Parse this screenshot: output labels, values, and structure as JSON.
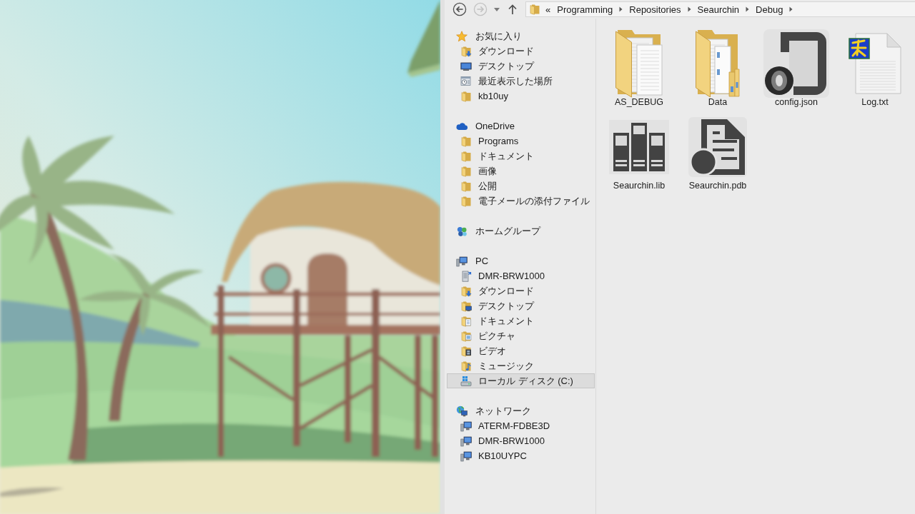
{
  "address_bar": {
    "nav_buttons": [
      {
        "kind": "back",
        "disabled": false
      },
      {
        "kind": "forward",
        "disabled": true
      },
      {
        "kind": "history",
        "disabled": false
      },
      {
        "kind": "up",
        "disabled": false
      }
    ],
    "overflow": "«",
    "path": [
      "Programming",
      "Repositories",
      "Seaurchin",
      "Debug"
    ]
  },
  "navigation": [
    {
      "label": "お気に入り",
      "kind": "star",
      "selected": false,
      "children": [
        {
          "label": "ダウンロード",
          "kind": "download",
          "selected": false
        },
        {
          "label": "デスクトップ",
          "kind": "desktop",
          "selected": false
        },
        {
          "label": "最近表示した場所",
          "kind": "recent",
          "selected": false
        },
        {
          "label": "kb10uy",
          "kind": "folder",
          "selected": false
        }
      ]
    },
    {
      "label": "OneDrive",
      "kind": "cloud",
      "selected": false,
      "children": [
        {
          "label": "Programs",
          "kind": "folder",
          "selected": false
        },
        {
          "label": "ドキュメント",
          "kind": "folder",
          "selected": false
        },
        {
          "label": "画像",
          "kind": "folder",
          "selected": false
        },
        {
          "label": "公開",
          "kind": "folder",
          "selected": false
        },
        {
          "label": "電子メールの添付ファイル",
          "kind": "folder",
          "selected": false
        }
      ]
    },
    {
      "label": "ホームグループ",
      "kind": "homegroup",
      "selected": false
    },
    {
      "label": "PC",
      "kind": "computer",
      "selected": false,
      "children": [
        {
          "label": "DMR-BRW1000",
          "kind": "media-server",
          "selected": false
        },
        {
          "label": "ダウンロード",
          "kind": "download",
          "selected": false
        },
        {
          "label": "デスクトップ",
          "kind": "desktop-folder",
          "selected": false
        },
        {
          "label": "ドキュメント",
          "kind": "documents",
          "selected": false
        },
        {
          "label": "ピクチャ",
          "kind": "pictures",
          "selected": false
        },
        {
          "label": "ビデオ",
          "kind": "videos",
          "selected": false
        },
        {
          "label": "ミュージック",
          "kind": "music",
          "selected": false
        },
        {
          "label": "ローカル ディスク (C:)",
          "kind": "drive",
          "selected": true
        }
      ]
    },
    {
      "label": "ネットワーク",
      "kind": "network",
      "selected": false,
      "children": [
        {
          "label": "ATERM-FDBE3D",
          "kind": "computer",
          "selected": false
        },
        {
          "label": "DMR-BRW1000",
          "kind": "computer",
          "selected": false
        },
        {
          "label": "KB10UYPC",
          "kind": "computer",
          "selected": false
        }
      ]
    }
  ],
  "files": [
    {
      "name": "AS_DEBUG",
      "kind": "folder-files",
      "selected": false
    },
    {
      "name": "Data",
      "kind": "folder-docs",
      "selected": false
    },
    {
      "name": "config.json",
      "kind": "json",
      "selected": false
    },
    {
      "name": "Log.txt",
      "kind": "text",
      "selected": false
    },
    {
      "name": "Seaurchin.lib",
      "kind": "library",
      "selected": false
    },
    {
      "name": "Seaurchin.pdb",
      "kind": "debug-db",
      "selected": false
    }
  ]
}
